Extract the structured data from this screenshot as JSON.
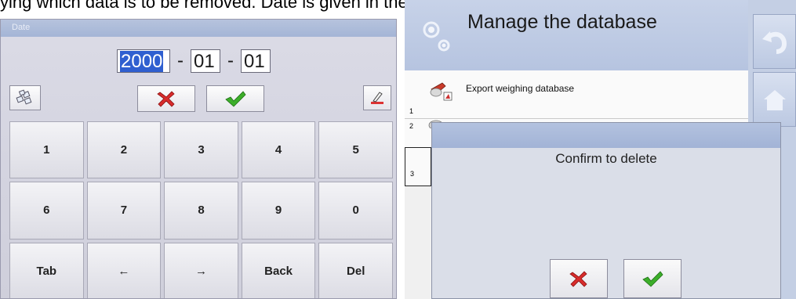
{
  "doc_text": "ying which data is to be removed. Date is given in the following form: year-mo",
  "keypad_panel": {
    "title": "Date",
    "date": {
      "year": "2000",
      "month": "01",
      "day": "01",
      "separator": "-"
    },
    "keys": [
      "1",
      "2",
      "3",
      "4",
      "5",
      "6",
      "7",
      "8",
      "9",
      "0",
      "Tab",
      "←",
      "→",
      "Back",
      "Del"
    ],
    "icons": {
      "left": "cluster-icon",
      "cancel": "red-x-icon",
      "ok": "green-check-icon",
      "right": "pen-eraser-icon"
    }
  },
  "database_panel": {
    "title": "Manage the database",
    "items": [
      {
        "num": "1",
        "label": "Export weighing database"
      },
      {
        "num": "2",
        "label": ""
      },
      {
        "num": "3",
        "label": ""
      }
    ],
    "dialog": {
      "message": "Confirm to delete"
    },
    "side_icons": [
      "undo-arrow-icon",
      "home-icon"
    ],
    "colors": {
      "accent": "#b3c2df",
      "cancel": "#e03030",
      "ok": "#43b02a"
    }
  }
}
